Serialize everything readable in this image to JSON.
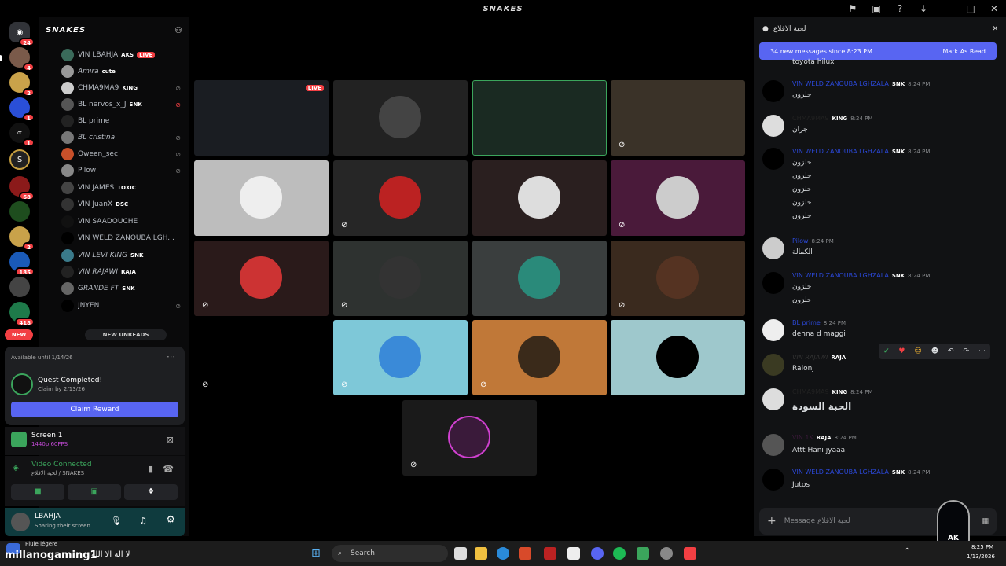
{
  "window": {
    "title": "SNAKES",
    "icons": [
      "flag-icon",
      "inbox-icon",
      "help-icon",
      "download-icon",
      "minimize-icon",
      "maximize-icon",
      "close-icon"
    ]
  },
  "server": {
    "name": "SNAKES"
  },
  "guild_badges": [
    "24",
    "4",
    "2",
    "1",
    "1",
    "68",
    "2",
    "185",
    "418"
  ],
  "guild_new": "NEW",
  "members": [
    {
      "name": "VIN LBAHJA",
      "tag": "AKS",
      "live": "LIVE"
    },
    {
      "name": "Amira",
      "tag": "cute"
    },
    {
      "name": "CHMA9MA9",
      "tag": "KING"
    },
    {
      "name": "BL nervos_x_J",
      "tag": "SNK"
    },
    {
      "name": "BL prime",
      "tag": ""
    },
    {
      "name": "BL cristina",
      "tag": ""
    },
    {
      "name": "Oween_sec",
      "tag": ""
    },
    {
      "name": "Pilow",
      "tag": ""
    },
    {
      "name": "VIN JAMES",
      "tag": "TOXIC"
    },
    {
      "name": "VIN JuanX",
      "tag": "DSC"
    },
    {
      "name": "VIN SAADOUCHE",
      "tag": ""
    },
    {
      "name": "VIN WELD ZANOUBA LGH...",
      "tag": ""
    },
    {
      "name": "VIN LEVI KING",
      "tag": "SNK"
    },
    {
      "name": "VIN RAJAWI",
      "tag": "RAJA"
    },
    {
      "name": "GRANDE FT",
      "tag": "SNK"
    },
    {
      "name": "JNYEN",
      "tag": ""
    }
  ],
  "new_unreads": "NEW UNREADS",
  "quest": {
    "available": "Available until 1/14/26",
    "title": "Quest Completed!",
    "claim_by": "Claim by 2/13/26",
    "button": "Claim Reward"
  },
  "screen": {
    "title": "Screen 1",
    "quality": "1440p 60FPS"
  },
  "voice": {
    "status": "Video Connected",
    "channel": "لحية الاقلاع / SNAKES"
  },
  "user": {
    "name": "LBAHJA",
    "status": "Sharing their screen"
  },
  "stage_live": "LIVE",
  "chat": {
    "channel": "لحية الاقلاع",
    "banner": "34 new messages since 8:23 PM",
    "mark_read": "Mark As Read",
    "top_line": "toyota hilux",
    "messages": [
      {
        "user": "VIN WELD ZANOUBA LGHZALA",
        "tag": "SNK",
        "time": "8:24 PM",
        "lines": [
          "حلزون"
        ]
      },
      {
        "user": "CHMA9MA9",
        "tag": "KING",
        "time": "8:24 PM",
        "lines": [
          "جران"
        ]
      },
      {
        "user": "VIN WELD ZANOUBA LGHZALA",
        "tag": "SNK",
        "time": "8:24 PM",
        "lines": [
          "حلزون",
          "حلزون",
          "حلزون",
          "حلزون",
          "حلزون"
        ]
      },
      {
        "user": "Pilow",
        "tag": "",
        "time": "8:24 PM",
        "lines": [
          "الكمالة"
        ]
      },
      {
        "user": "VIN WELD ZANOUBA LGHZALA",
        "tag": "SNK",
        "time": "8:24 PM",
        "lines": [
          "حلزون",
          "حلزون"
        ]
      },
      {
        "user": "BL prime",
        "tag": "",
        "time": "8:24 PM",
        "lines": [
          "dehna d maggi"
        ]
      },
      {
        "user": "VIN RAJAWI",
        "tag": "RAJA",
        "time": "",
        "lines": [
          "Ralonj"
        ]
      },
      {
        "user": "CHMA9MA9",
        "tag": "KING",
        "time": "8:24 PM",
        "lines": [
          "الحبة السودة"
        ]
      },
      {
        "user": "VIN 1K",
        "tag": "RAJA",
        "time": "8:24 PM",
        "lines": [
          "Attt Hani jyaaa"
        ]
      },
      {
        "user": "VIN WELD ZANOUBA LGHZALA",
        "tag": "SNK",
        "time": "8:24 PM",
        "lines": [
          "Jutos"
        ]
      }
    ],
    "input_placeholder": "Message لحية الاقلاع"
  },
  "badge_logo": "AK",
  "taskbar": {
    "weather": "Pluie légère",
    "user": "millanogaming1",
    "text": "لا اله الا الله",
    "search": "Search",
    "time": "8:25 PM",
    "date": "1/13/2026"
  }
}
